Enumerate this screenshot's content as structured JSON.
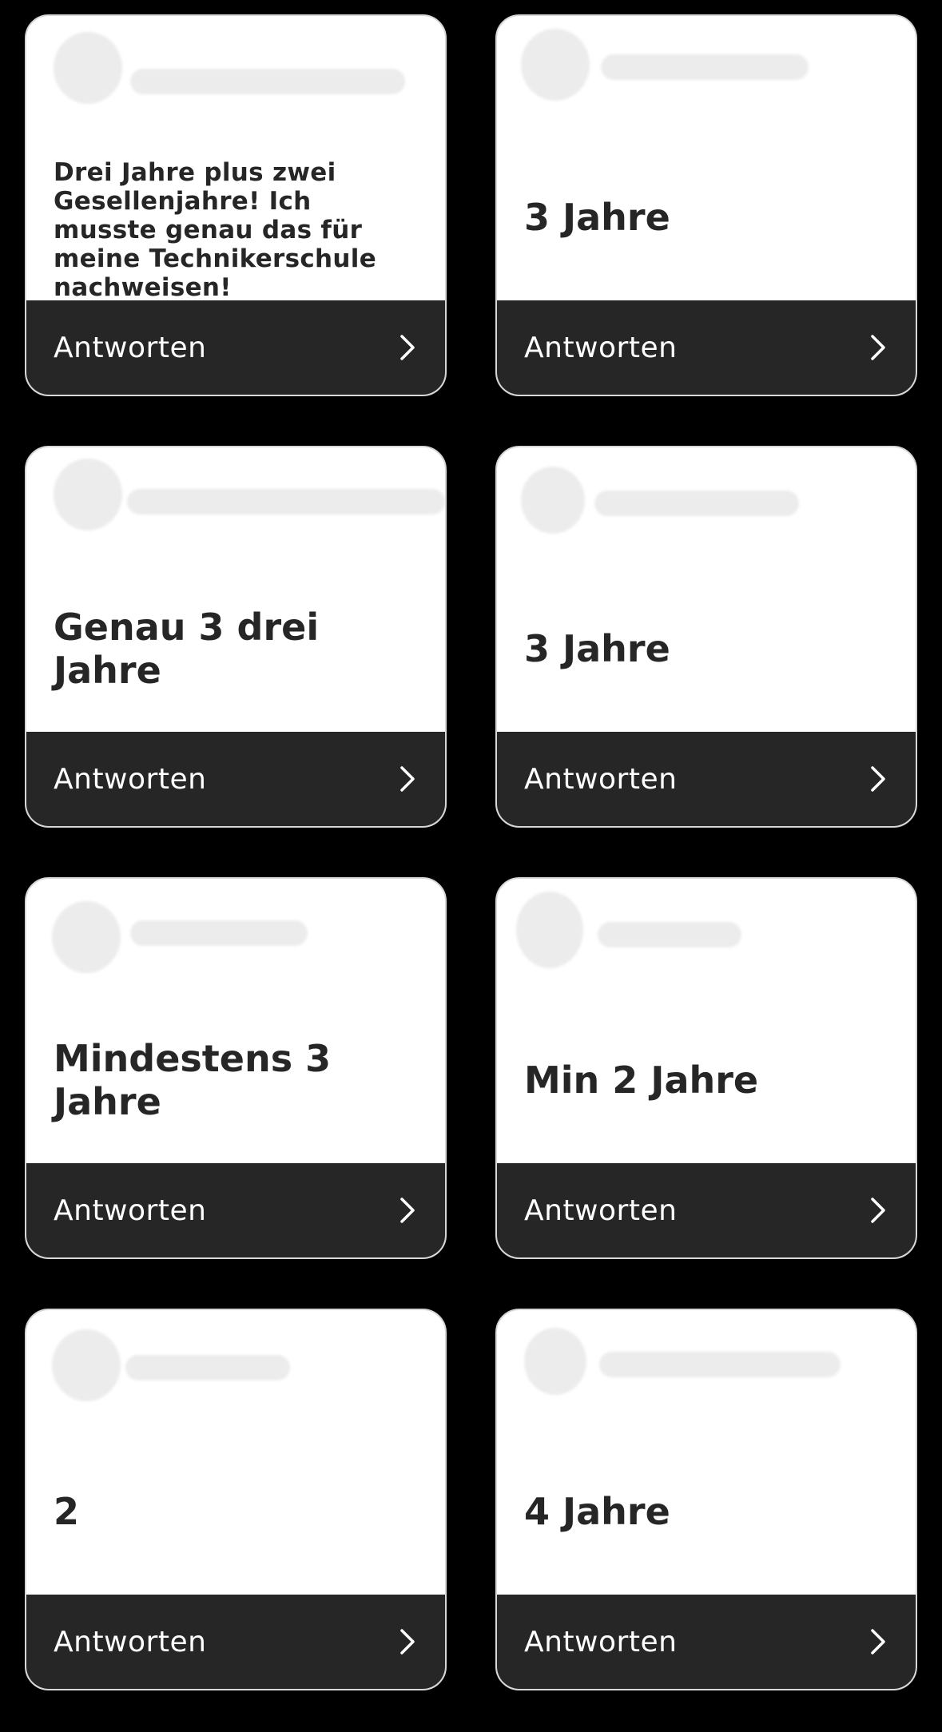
{
  "colors": {
    "page_background": "#000000",
    "card_background": "#ffffff",
    "reply_bar": "#262626",
    "answer_text": "#262626"
  },
  "cards": [
    {
      "answer": "Drei Jahre plus zwei Gesellenjahre! Ich musste genau das für meine Technikerschule nachweisen!",
      "reply_label": "Antworten",
      "icon": "chevron-right-icon"
    },
    {
      "answer": "3 Jahre",
      "reply_label": "Antworten",
      "icon": "chevron-right-icon"
    },
    {
      "answer": "Genau 3 drei Jahre",
      "reply_label": "Antworten",
      "icon": "chevron-right-icon"
    },
    {
      "answer": "3 Jahre",
      "reply_label": "Antworten",
      "icon": "chevron-right-icon"
    },
    {
      "answer": "Mindestens 3 Jahre",
      "reply_label": "Antworten",
      "icon": "chevron-right-icon"
    },
    {
      "answer": "Min 2 Jahre",
      "reply_label": "Antworten",
      "icon": "chevron-right-icon"
    },
    {
      "answer": "2",
      "reply_label": "Antworten",
      "icon": "chevron-right-icon"
    },
    {
      "answer": "4 Jahre",
      "reply_label": "Antworten",
      "icon": "chevron-right-icon"
    }
  ]
}
